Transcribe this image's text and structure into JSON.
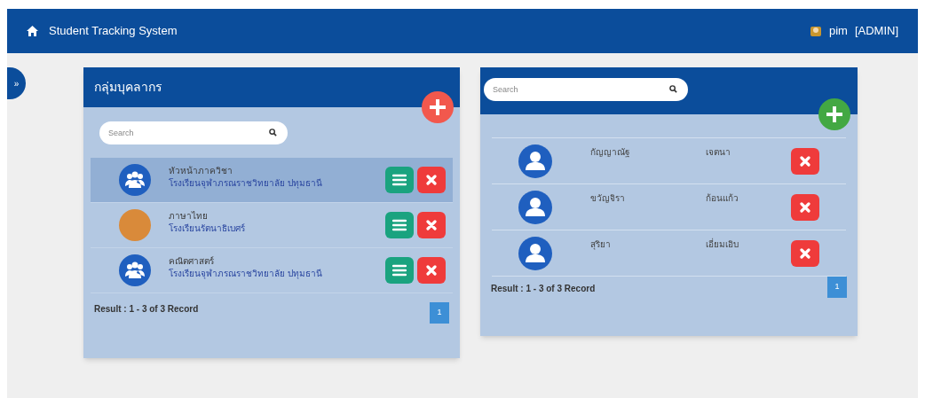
{
  "navbar": {
    "title": "Student Tracking System",
    "user": "pim",
    "role": "[ADMIN]"
  },
  "sidebar_toggle": "»",
  "groups_panel": {
    "title": "กลุ่มบุคลากร",
    "search": {
      "placeholder": "Search"
    },
    "rows": [
      {
        "name": "หัวหน้าภาควิชา",
        "school": "โรงเรียนจุฬาภรณราชวิทยาลัย ปทุมธานี",
        "kind": "group",
        "selected": true
      },
      {
        "name": "ภาษาไทย",
        "school": "โรงเรียนรัตนาธิเบศร์",
        "kind": "photo",
        "selected": false
      },
      {
        "name": "คณิตศาสตร์",
        "school": "โรงเรียนจุฬาภรณราชวิทยาลัย ปทุมธานี",
        "kind": "group",
        "selected": false
      }
    ],
    "result": "Result : 1 - 3 of 3 Record",
    "pages": [
      {
        "label": "1",
        "selected": true
      }
    ]
  },
  "members_panel": {
    "search": {
      "placeholder": "Search"
    },
    "rows": [
      {
        "first_name": "กัญญาณัฐ",
        "last_name": "เจตนา"
      },
      {
        "first_name": "ขวัญจิรา",
        "last_name": "ก้อนแก้ว"
      },
      {
        "first_name": "สุริยา",
        "last_name": "เอี่ยมเอิบ"
      }
    ],
    "result": "Result : 1 - 3 of 3 Record",
    "pages": [
      {
        "label": "1",
        "selected": true
      }
    ]
  }
}
